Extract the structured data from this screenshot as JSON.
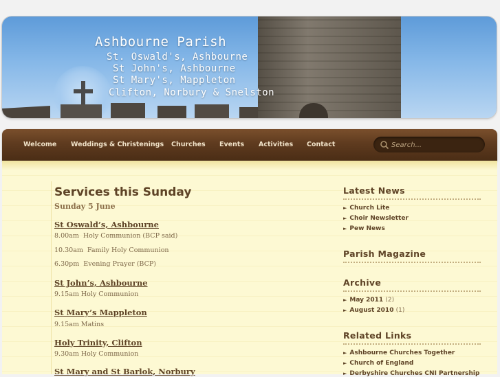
{
  "banner": {
    "title": "Ashbourne Parish",
    "lines": [
      "St. Oswald's, Ashbourne",
      "St John's, Ashbourne",
      "St Mary's, Mappleton",
      "Clifton, Norbury & Snelston"
    ]
  },
  "nav": {
    "items": [
      "Welcome",
      "Weddings & Christenings",
      "Churches",
      "Events",
      "Activities",
      "Contact"
    ],
    "search_placeholder": "Search..."
  },
  "main": {
    "heading": "Services this Sunday",
    "date": "Sunday 5 June",
    "churches": [
      {
        "name": "St Oswald’s, Ashbourne",
        "services": [
          "8.00am  Holy Communion (BCP said)",
          "10.30am  Family Holy Communion",
          "6.30pm  Evening Prayer (BCP)"
        ]
      },
      {
        "name": "St John’s, Ashbourne",
        "services": [
          "9.15am Holy Communion"
        ]
      },
      {
        "name": "St Mary’s Mappleton",
        "services": [
          "9.15am Matins"
        ]
      },
      {
        "name": "Holy Trinity, Clifton",
        "services": [
          "9.30am Holy Communion"
        ]
      },
      {
        "name": "St Mary and St Barlok, Norbury",
        "services": []
      }
    ]
  },
  "sidebar": {
    "latest_news": {
      "title": "Latest News",
      "items": [
        "Church Lite",
        "Choir Newsletter",
        "Pew News"
      ]
    },
    "parish_magazine": {
      "title": "Parish Magazine"
    },
    "archive": {
      "title": "Archive",
      "items": [
        {
          "label": "May 2011",
          "count": "(2)"
        },
        {
          "label": "August 2010",
          "count": "(1)"
        }
      ]
    },
    "related_links": {
      "title": "Related Links",
      "items": [
        "Ashbourne Churches Together",
        "Church of England",
        "Derbyshire Churches CNI Partnership"
      ]
    }
  },
  "colors": {
    "nav_bg": "#5f3b1f",
    "heading": "#5e4326",
    "content_bg": "#fdf9d3",
    "sky": "#86b8e8"
  }
}
